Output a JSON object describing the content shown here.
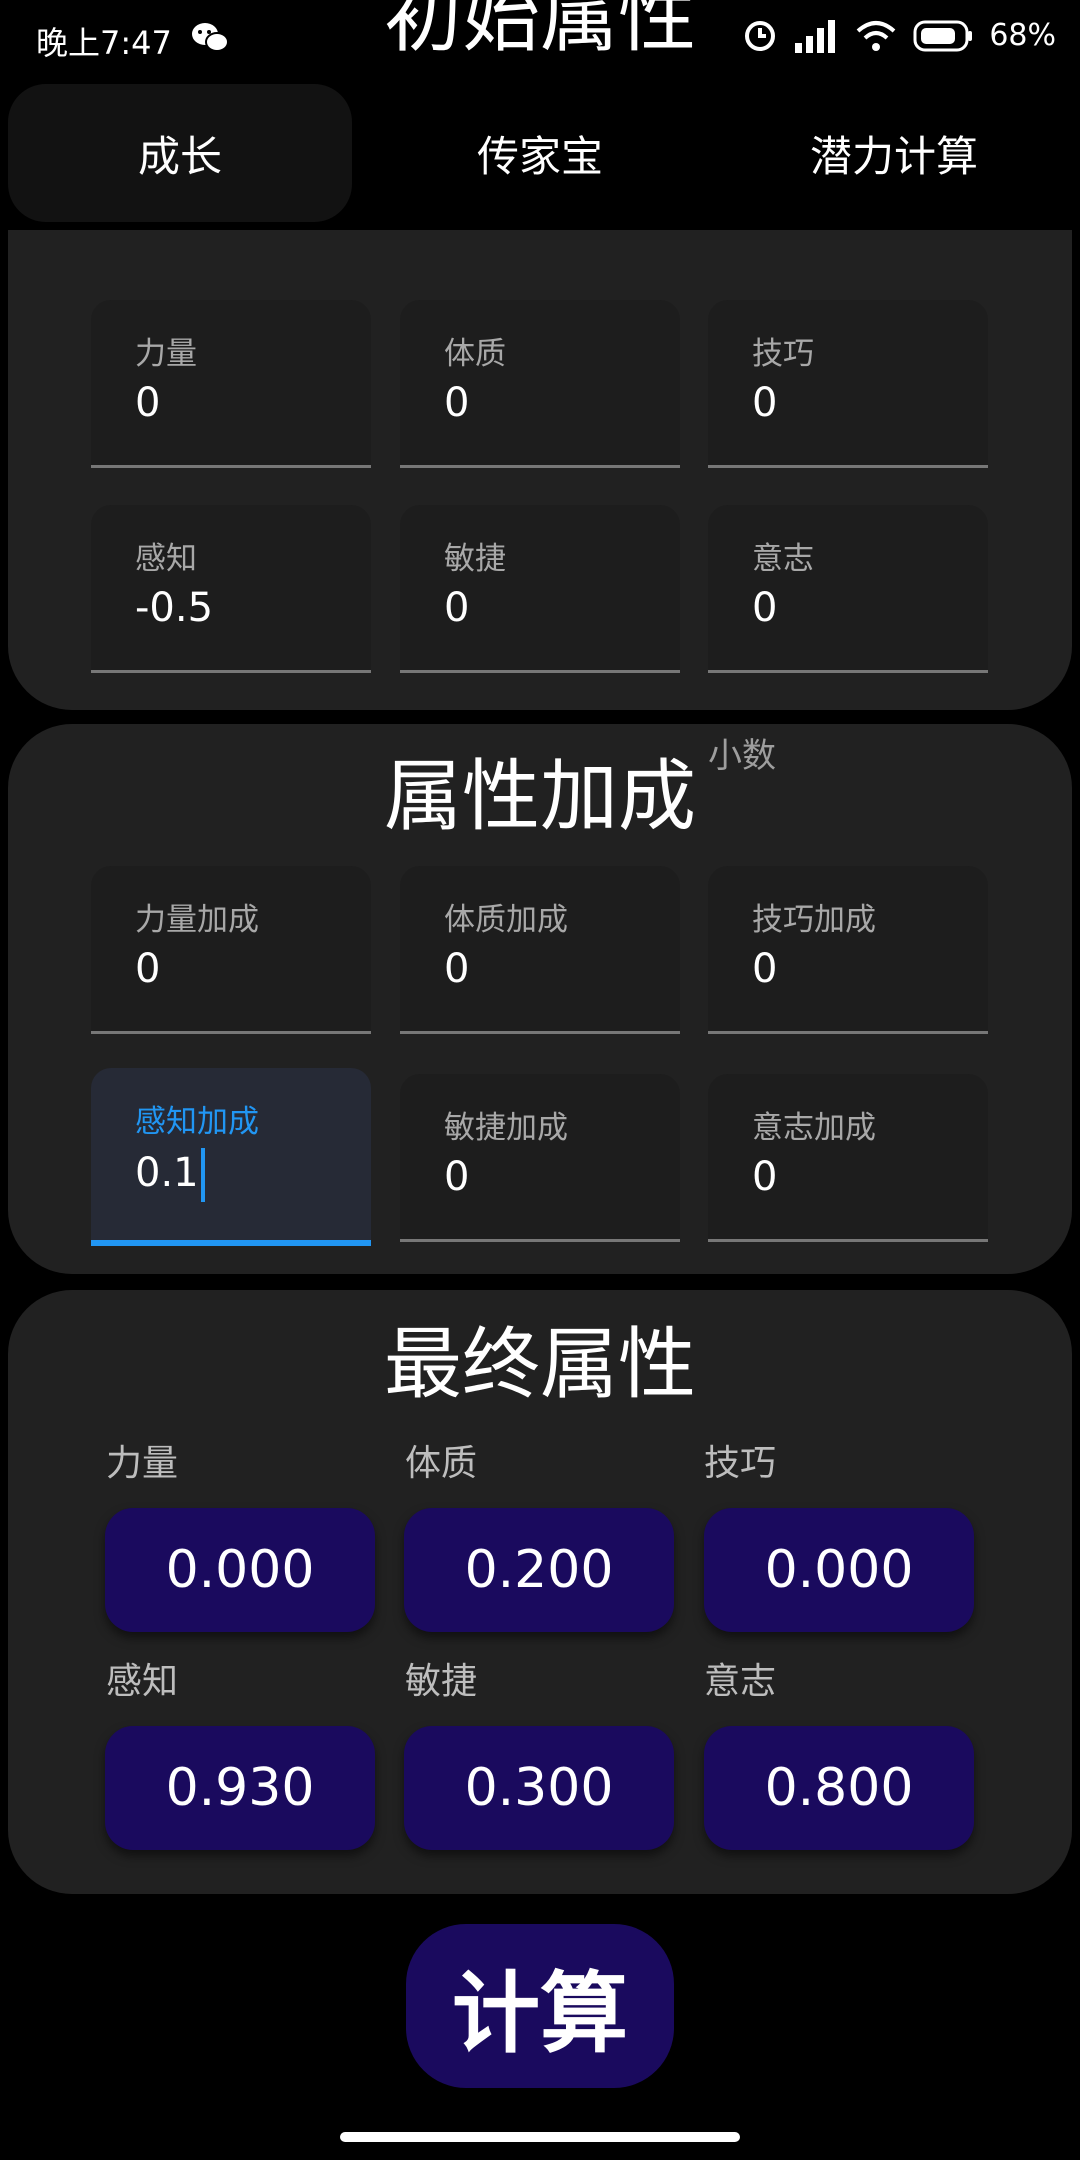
{
  "status": {
    "time": "晚上7:47",
    "battery": "68%"
  },
  "tabs": [
    {
      "label": "成长",
      "selected": true
    },
    {
      "label": "传家宝",
      "selected": false
    },
    {
      "label": "潜力计算",
      "selected": false
    }
  ],
  "initial": {
    "title": "初始属性",
    "fields": [
      {
        "label": "力量",
        "value": "0"
      },
      {
        "label": "体质",
        "value": "0"
      },
      {
        "label": "技巧",
        "value": "0"
      },
      {
        "label": "感知",
        "value": "-0.5"
      },
      {
        "label": "敏捷",
        "value": "0"
      },
      {
        "label": "意志",
        "value": "0"
      }
    ]
  },
  "bonus": {
    "title": "属性加成",
    "hint": "小数",
    "fields": [
      {
        "label": "力量加成",
        "value": "0"
      },
      {
        "label": "体质加成",
        "value": "0"
      },
      {
        "label": "技巧加成",
        "value": "0"
      },
      {
        "label": "感知加成",
        "value": "0.1"
      },
      {
        "label": "敏捷加成",
        "value": "0"
      },
      {
        "label": "意志加成",
        "value": "0"
      }
    ]
  },
  "final": {
    "title": "最终属性",
    "items": [
      {
        "label": "力量",
        "value": "0.000"
      },
      {
        "label": "体质",
        "value": "0.200"
      },
      {
        "label": "技巧",
        "value": "0.000"
      },
      {
        "label": "感知",
        "value": "0.930"
      },
      {
        "label": "敏捷",
        "value": "0.300"
      },
      {
        "label": "意志",
        "value": "0.800"
      }
    ]
  },
  "calc_button": "计算",
  "colors": {
    "card": "#212121",
    "accent": "#2196f3",
    "value_box": "#1a0a5e"
  }
}
